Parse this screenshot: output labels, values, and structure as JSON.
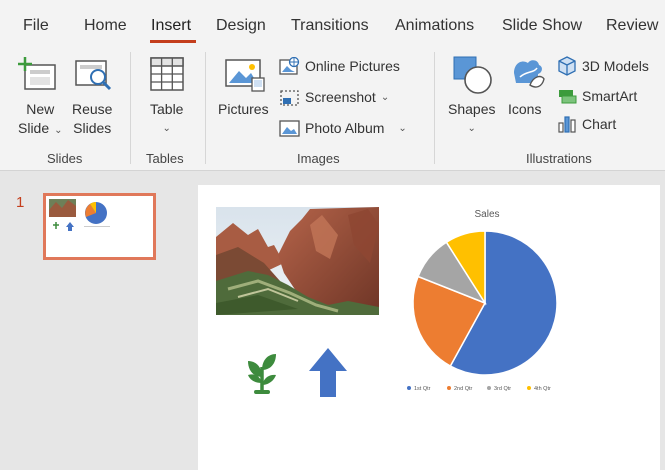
{
  "tabs": [
    "File",
    "Home",
    "Insert",
    "Design",
    "Transitions",
    "Animations",
    "Slide Show",
    "Review"
  ],
  "active_tab": "Insert",
  "ribbon": {
    "slides": {
      "new_slide_line1": "New",
      "new_slide_line2": "Slide",
      "reuse_line1": "Reuse",
      "reuse_line2": "Slides",
      "label": "Slides"
    },
    "tables": {
      "table": "Table",
      "label": "Tables"
    },
    "images": {
      "pictures": "Pictures",
      "online_pictures": "Online Pictures",
      "screenshot": "Screenshot",
      "photo_album": "Photo Album",
      "label": "Images"
    },
    "illustrations": {
      "shapes": "Shapes",
      "icons": "Icons",
      "models_3d": "3D Models",
      "smartart": "SmartArt",
      "chart": "Chart",
      "label": "Illustrations"
    }
  },
  "thumbnails": {
    "slide_number": "1"
  },
  "chart_data": {
    "type": "pie",
    "title": "Sales",
    "categories": [
      "1st Qtr",
      "2nd Qtr",
      "3rd Qtr",
      "4th Qtr"
    ],
    "values": [
      58,
      23,
      10,
      9
    ],
    "colors": [
      "#4472c4",
      "#ed7d31",
      "#a5a5a5",
      "#ffc000"
    ],
    "legend_position": "bottom"
  },
  "colors": {
    "accent": "#c43e1c",
    "thumb_border": "#e0785a",
    "arrow": "#4472c4",
    "plant": "#3d8b3d"
  }
}
